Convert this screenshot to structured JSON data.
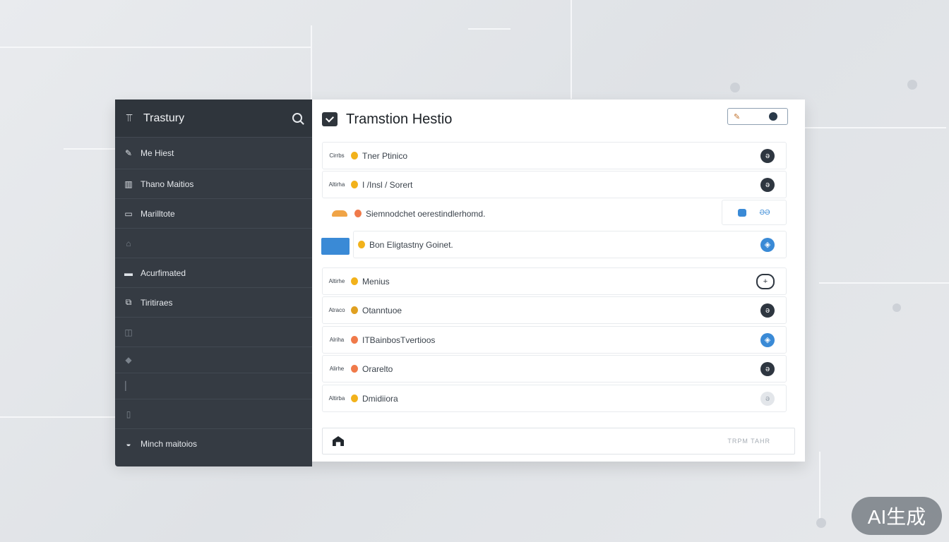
{
  "sidebar": {
    "title": "Trastury",
    "items": [
      {
        "label": "Me   Hiest",
        "icon": "wrench-icon"
      },
      {
        "label": "Thano Maitios",
        "icon": "building-icon"
      },
      {
        "label": "Marilltote",
        "icon": "window-icon"
      },
      {
        "label": "",
        "icon": "lock-icon"
      },
      {
        "label": "Acurfimated",
        "icon": "card-icon"
      },
      {
        "label": "Tiritiraes",
        "icon": "link-icon"
      },
      {
        "label": "",
        "icon": "chart-icon"
      },
      {
        "label": "",
        "icon": "dot-icon"
      },
      {
        "label": "",
        "icon": "bar-icon"
      },
      {
        "label": "",
        "icon": "file-icon"
      },
      {
        "label": "Minch  maitoios",
        "icon": "cup-icon"
      }
    ]
  },
  "main": {
    "title": "Tramstion Hestio",
    "rows": [
      {
        "tag": "Cirrbs",
        "label": "Tner Ptinico",
        "dot_color": "#f2b21b",
        "action": "dark"
      },
      {
        "tag": "Altirha",
        "label": "I /Insl / Sorert",
        "dot_color": "#f2b21b",
        "action": "dark"
      },
      {
        "tag": "",
        "label": "Siemnodchet oerestindlerhomd.",
        "dot_color": "#f07a4a",
        "action": "aux"
      },
      {
        "tag": "",
        "label": "Bon  Eligtastny Goinet.",
        "dot_color": "#f2b21b",
        "action": "blue"
      },
      {
        "tag": "Altirhe",
        "label": "Menius",
        "dot_color": "#f2b21b",
        "action": "plus"
      },
      {
        "tag": "Atraco",
        "label": "Otanntuoe",
        "dot_color": "#e0a020",
        "action": "dark"
      },
      {
        "tag": "Alriha",
        "label": "ITBainbosTvertioos",
        "dot_color": "#f07a4a",
        "action": "blue"
      },
      {
        "tag": "Alirhe",
        "label": "Orarelto",
        "dot_color": "#f07a4a",
        "action": "dark"
      },
      {
        "tag": "Altirba",
        "label": "Dmidiiora",
        "dot_color": "#f2b21b",
        "action": "light"
      }
    ],
    "aux_text": "ƏƏ",
    "footer_right": "TRPM  TAHR"
  },
  "watermark": "AI生成"
}
